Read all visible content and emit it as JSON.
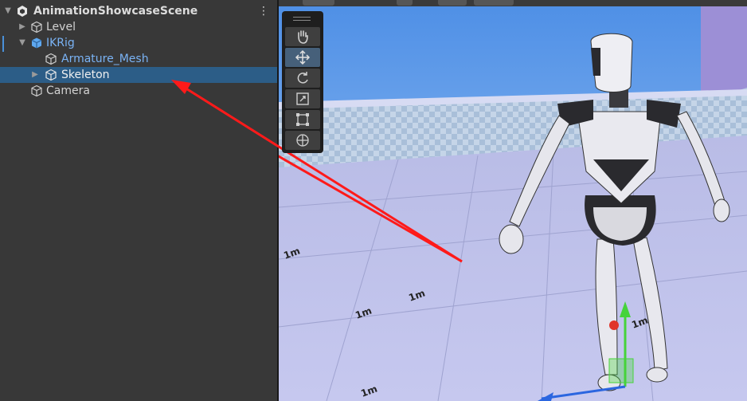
{
  "hierarchy": {
    "scene_name": "AnimationShowcaseScene",
    "items": [
      {
        "label": "Level",
        "expanded": false,
        "icon": "gameobject-icon",
        "prefab": false
      },
      {
        "label": "IKRig",
        "expanded": true,
        "icon": "prefab-icon",
        "prefab": true
      },
      {
        "label": "Armature_Mesh",
        "expanded": null,
        "icon": "gameobject-icon",
        "prefab": true
      },
      {
        "label": "Skeleton",
        "expanded": false,
        "icon": "gameobject-icon",
        "prefab": false,
        "selected": true
      },
      {
        "label": "Camera",
        "expanded": null,
        "icon": "gameobject-icon",
        "prefab": false
      }
    ]
  },
  "scene_tools": [
    "hand-tool",
    "move-tool",
    "rotate-tool",
    "scale-tool",
    "rect-tool",
    "transform-tool"
  ],
  "colors": {
    "panel_bg": "#383838",
    "selection": "#2c5d87",
    "prefab_text": "#7ab3f5",
    "annotation_arrow": "#ff1a1a",
    "gizmo_y": "#46d33a",
    "gizmo_x": "#e0342a",
    "gizmo_z": "#2b66e0"
  }
}
